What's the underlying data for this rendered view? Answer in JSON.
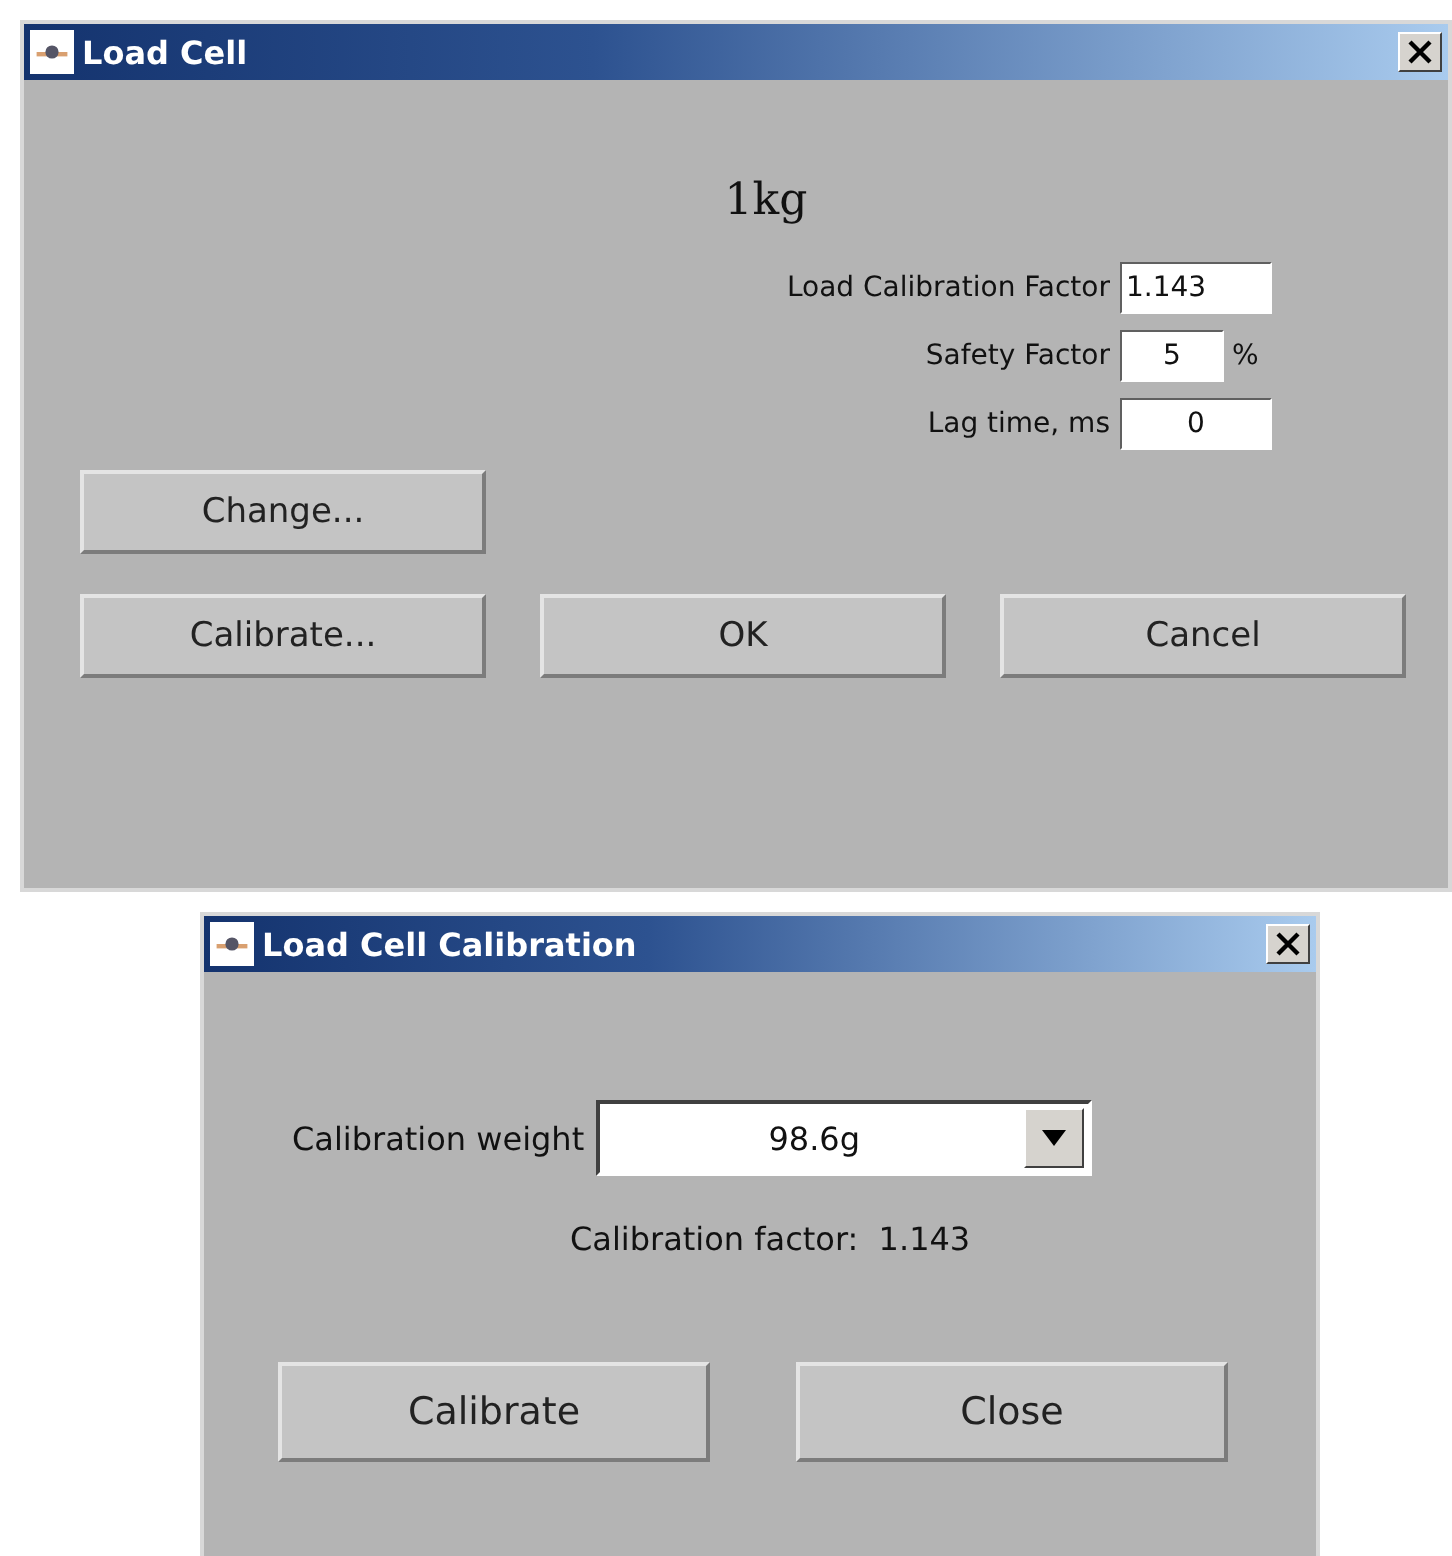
{
  "load_cell_window": {
    "title": "Load Cell",
    "heading": "1kg",
    "fields": [
      {
        "label": "Load Calibration Factor",
        "value": "1.143"
      },
      {
        "label": "Safety Factor",
        "value": "5",
        "suffix": "%"
      },
      {
        "label": "Lag time, ms",
        "value": "0"
      }
    ],
    "buttons": [
      "Change...",
      "Calibrate...",
      "OK",
      "Cancel"
    ]
  },
  "calibration_window": {
    "title": "Load Cell Calibration",
    "weight_label": "Calibration weight",
    "weight_value": "98.6g",
    "factor_text": "Calibration factor:  1.143",
    "buttons": [
      "Calibrate",
      "Close"
    ]
  }
}
